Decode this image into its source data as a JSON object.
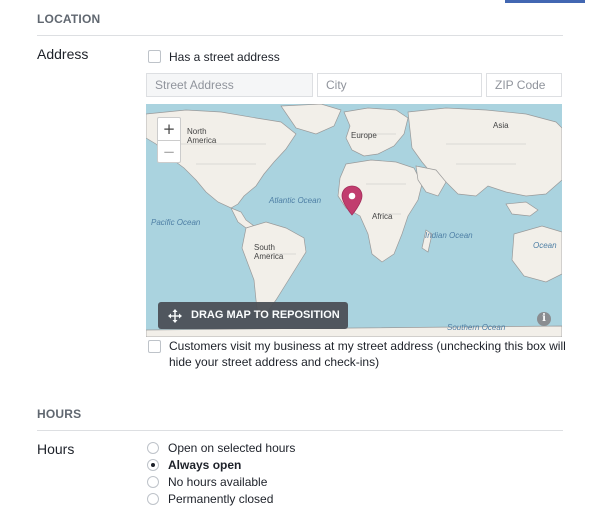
{
  "location": {
    "section_title": "LOCATION",
    "address_label": "Address",
    "street_checkbox_label": "Has a street address",
    "street_placeholder": "Street Address",
    "city_placeholder": "City",
    "zip_placeholder": "ZIP Code",
    "map": {
      "labels": {
        "north_america": "North\nAmerica",
        "europe": "Europe",
        "asia": "Asia",
        "africa": "Africa",
        "south_america": "South\nAmerica",
        "atlantic": "Atlantic Ocean",
        "pacific": "Pacific Ocean",
        "indian": "Indian Ocean",
        "ocean": "Ocean",
        "southern": "Southern Ocean"
      },
      "zoom_in": "+",
      "zoom_out": "−",
      "drag_button": "DRAG MAP TO REPOSITION",
      "info": "i",
      "pin_color": "#c13d6e"
    },
    "visit_checkbox_label": "Customers visit my business at my street address (unchecking this box will hide your street address and check-ins)"
  },
  "hours": {
    "section_title": "HOURS",
    "label": "Hours",
    "options": [
      {
        "label": "Open on selected hours",
        "checked": false
      },
      {
        "label": "Always open",
        "checked": true
      },
      {
        "label": "No hours available",
        "checked": false
      },
      {
        "label": "Permanently closed",
        "checked": false
      }
    ]
  },
  "colors": {
    "accent": "#4267b2",
    "ocean": "#aad3df",
    "land": "#f2efe9"
  }
}
